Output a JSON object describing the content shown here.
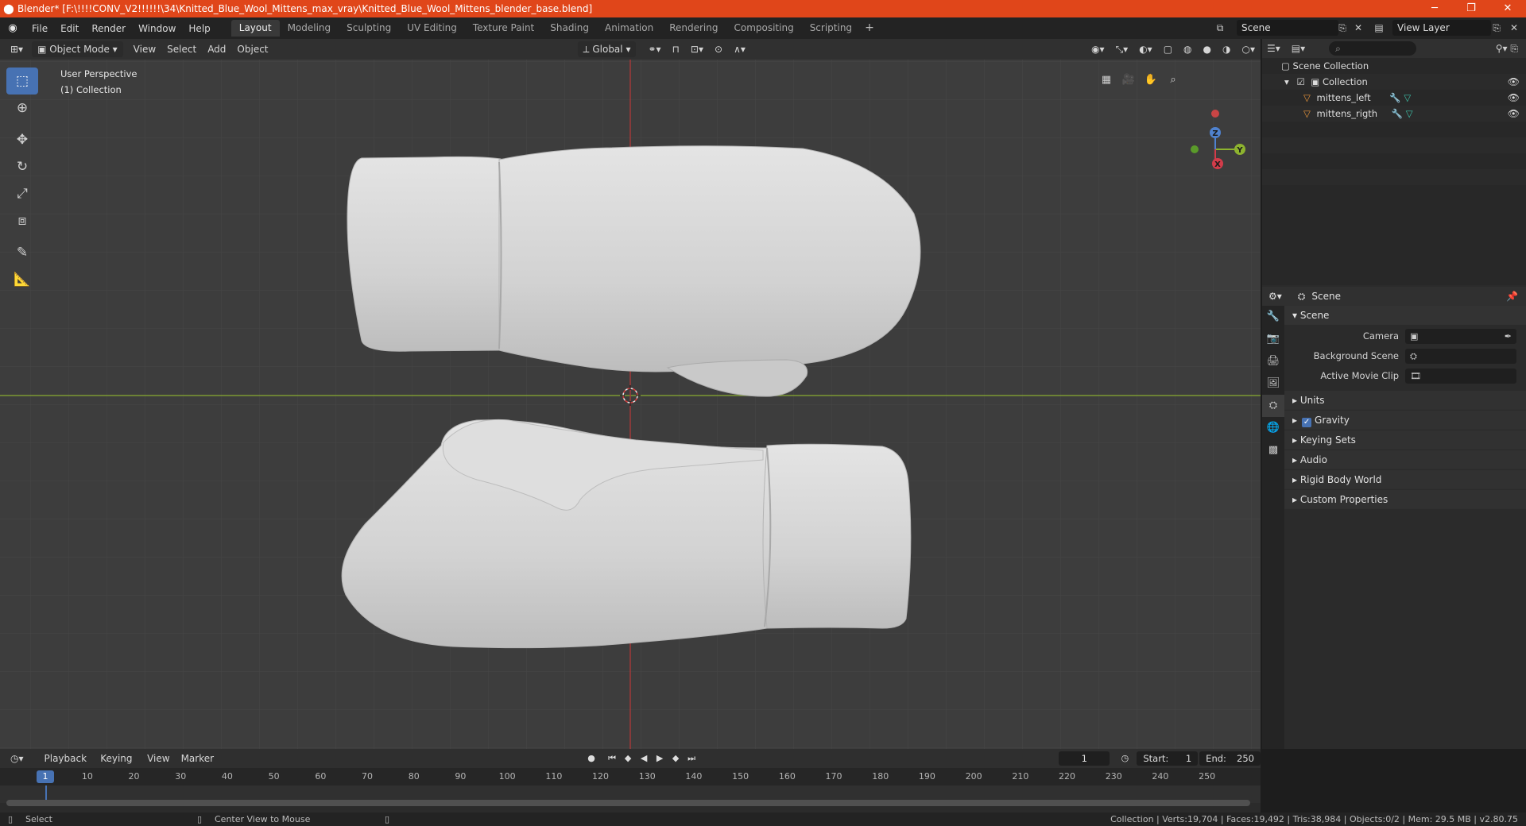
{
  "window": {
    "title": "Blender* [F:\\!!!!CONV_V2!!!!!!\\34\\Knitted_Blue_Wool_Mittens_max_vray\\Knitted_Blue_Wool_Mittens_blender_base.blend]",
    "accent_color": "#e0461a"
  },
  "menubar": {
    "items": [
      "File",
      "Edit",
      "Render",
      "Window",
      "Help"
    ],
    "tabs": [
      "Layout",
      "Modeling",
      "Sculpting",
      "UV Editing",
      "Texture Paint",
      "Shading",
      "Animation",
      "Rendering",
      "Compositing",
      "Scripting"
    ],
    "active_tab": "Layout",
    "scene": "Scene",
    "view_layer": "View Layer"
  },
  "viewport": {
    "mode": "Object Mode",
    "menus": [
      "View",
      "Select",
      "Add",
      "Object"
    ],
    "transform_orientation": "Global",
    "overlay_line1": "User Perspective",
    "overlay_line2": "(1) Collection",
    "background_color": "#3d3d3d",
    "gizmo": {
      "x": "X",
      "y": "Y",
      "z": "Z"
    }
  },
  "outliner": {
    "root": "Scene Collection",
    "collection": "Collection",
    "objects": [
      "mittens_left",
      "mittens_rigth"
    ]
  },
  "properties": {
    "context": "Scene",
    "panel": "Scene",
    "fields": [
      {
        "label": "Camera",
        "value": ""
      },
      {
        "label": "Background Scene",
        "value": ""
      },
      {
        "label": "Active Movie Clip",
        "value": ""
      }
    ],
    "subpanels": [
      "Units",
      "Gravity",
      "Keying Sets",
      "Audio",
      "Rigid Body World",
      "Custom Properties"
    ]
  },
  "timeline": {
    "menus": [
      "Playback",
      "Keying",
      "View",
      "Marker"
    ],
    "current_frame": "1",
    "start_label": "Start:",
    "start": "1",
    "end_label": "End:",
    "end": "250",
    "ticks": [
      "10",
      "20",
      "30",
      "40",
      "50",
      "60",
      "70",
      "80",
      "90",
      "100",
      "110",
      "120",
      "130",
      "140",
      "150",
      "160",
      "170",
      "180",
      "190",
      "200",
      "210",
      "220",
      "230",
      "240",
      "250"
    ]
  },
  "statusbar": {
    "left": "Select",
    "middle": "Center View to Mouse",
    "right": "Collection | Verts:19,704 | Faces:19,492 | Tris:38,984 | Objects:0/2 | Mem: 29.5 MB | v2.80.75"
  }
}
